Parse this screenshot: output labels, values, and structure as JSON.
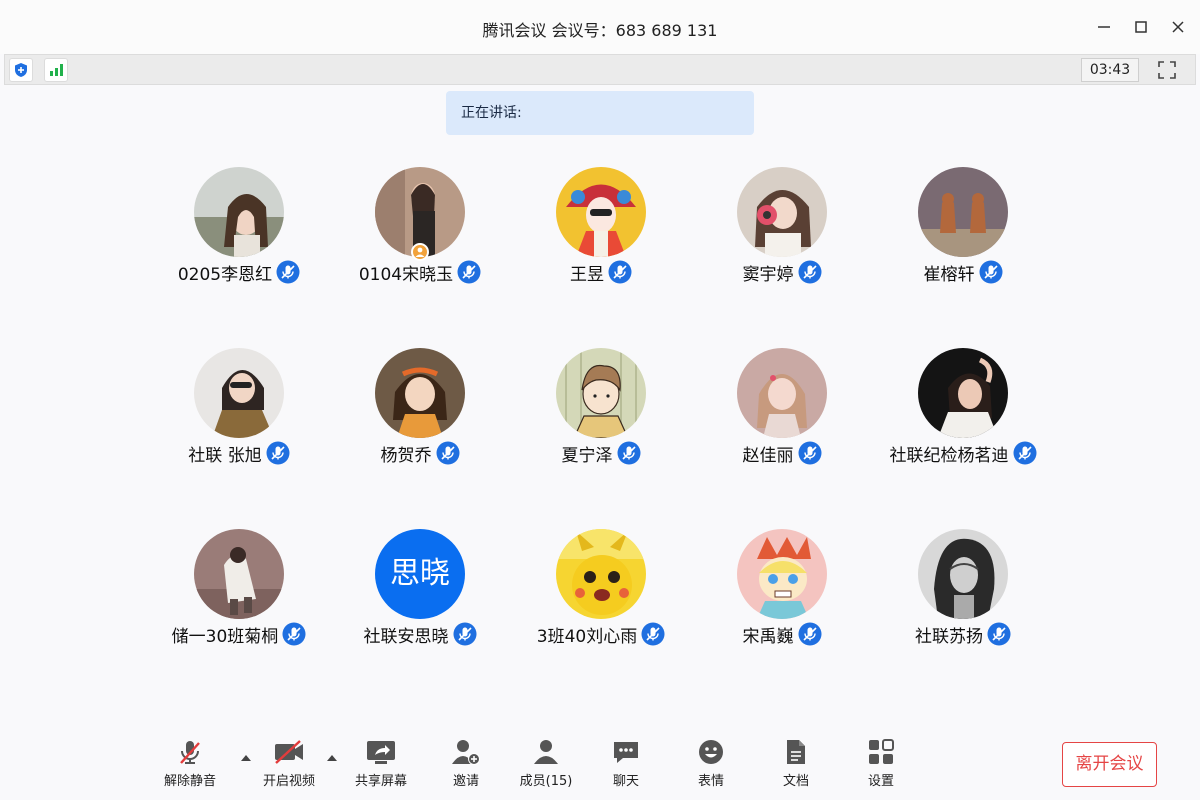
{
  "window": {
    "title": "腾讯会议 会议号：683 689 131"
  },
  "infobar": {
    "timer": "03:43"
  },
  "speaking": {
    "label": "正在讲话:"
  },
  "participants": [
    {
      "name": "0205李恩红"
    },
    {
      "name": "0104宋晓玉",
      "host": true
    },
    {
      "name": "王昱"
    },
    {
      "name": "窦宇婷"
    },
    {
      "name": "崔榕轩"
    },
    {
      "name": "社联 张旭"
    },
    {
      "name": "杨贺乔"
    },
    {
      "name": "夏宁泽"
    },
    {
      "name": "赵佳丽"
    },
    {
      "name": "社联纪检杨茗迪"
    },
    {
      "name": "储一30班菊桐"
    },
    {
      "name": "社联安思晓",
      "avatar_text": "思晓"
    },
    {
      "name": "3班40刘心雨"
    },
    {
      "name": "宋禹巍"
    },
    {
      "name": "社联苏扬"
    }
  ],
  "toolbar": {
    "unmute": "解除静音",
    "start_video": "开启视频",
    "share_screen": "共享屏幕",
    "invite": "邀请",
    "members": "成员(15)",
    "chat": "聊天",
    "reactions": "表情",
    "docs": "文档",
    "settings": "设置",
    "leave": "离开会议"
  },
  "colors": {
    "accent": "#0a6ef0",
    "mic_badge": "#1f6fe0",
    "leave": "#e54545",
    "speaking_bg": "#dbe9fb",
    "signal": "#22b14c"
  }
}
